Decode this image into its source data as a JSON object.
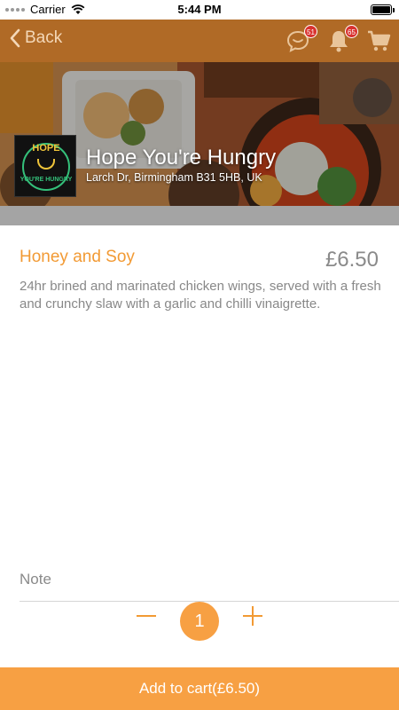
{
  "status_bar": {
    "carrier": "Carrier",
    "time": "5:44 PM"
  },
  "nav": {
    "back_label": "Back",
    "chat_badge": "51",
    "notification_badge": "65",
    "icons": [
      "chevron-left-icon",
      "chat-bubble-icon",
      "bell-icon",
      "cart-icon"
    ],
    "bar_color": "#b06a26"
  },
  "restaurant": {
    "name": "Hope You're Hungry",
    "address": "Larch Dr, Birmingham B31 5HB, UK",
    "logo_text_top": "HOPE",
    "logo_text_bottom": "YOU'RE HUNGRY"
  },
  "item": {
    "name": "Honey and Soy",
    "price": "£6.50",
    "description": "24hr brined and marinated chicken wings, served with a fresh and crunchy slaw with a garlic and chilli vinaigrette."
  },
  "note": {
    "label": "Note"
  },
  "quantity": {
    "value": "1"
  },
  "cart_button": {
    "label": "Add to cart(£6.50)"
  },
  "colors": {
    "accent": "#f7a043",
    "item_name": "#f29a34",
    "muted_text": "#888888"
  }
}
